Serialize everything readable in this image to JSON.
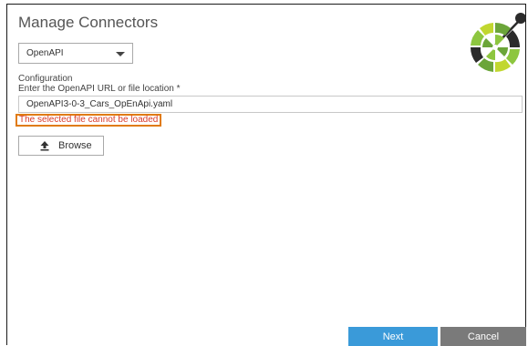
{
  "dialog": {
    "title": "Manage Connectors"
  },
  "connector_select": {
    "value": "OpenAPI"
  },
  "configuration": {
    "section_label": "Configuration",
    "url_label": "Enter the OpenAPI URL or file location *",
    "url_value": "OpenAPI3-0-3_Cars_OpEnApi.yaml",
    "error_message": "The selected file cannot be loaded"
  },
  "browse_button": {
    "label": "Browse",
    "icon": "upload-icon"
  },
  "footer": {
    "next_label": "Next",
    "cancel_label": "Cancel"
  },
  "logo": {
    "icon": "openapi-logo-icon",
    "colors": [
      "#2b2b2b",
      "#6ba539",
      "#8dc63f",
      "#c1d72f"
    ]
  },
  "colors": {
    "primary_button": "#3a9ad9",
    "secondary_button": "#7a7a7a",
    "error_text": "#d93a2b",
    "error_highlight": "#e07b12"
  }
}
